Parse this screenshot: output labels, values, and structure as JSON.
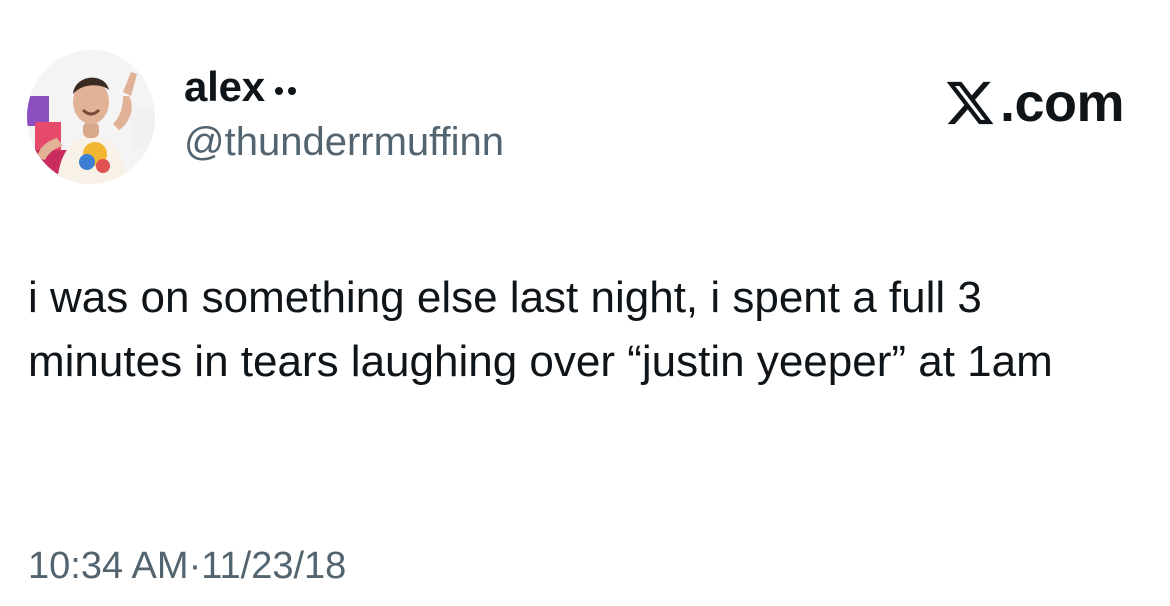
{
  "tweet": {
    "author": {
      "display_name": "alex",
      "handle": "@thunderrmuffinn",
      "name_decoration_icon": "two-dots-icon",
      "avatar_icon": "profile-photo"
    },
    "brand": {
      "icon": "x-logo-icon",
      "label": ".com"
    },
    "text": "i was on something else last night, i spent a full 3 minutes in tears laughing over “justin yeeper” at 1am",
    "time": "10:34 AM",
    "separator": " · ",
    "date": "11/23/18"
  },
  "colors": {
    "text_primary": "#0f1419",
    "text_secondary": "#536471",
    "background": "#ffffff"
  }
}
